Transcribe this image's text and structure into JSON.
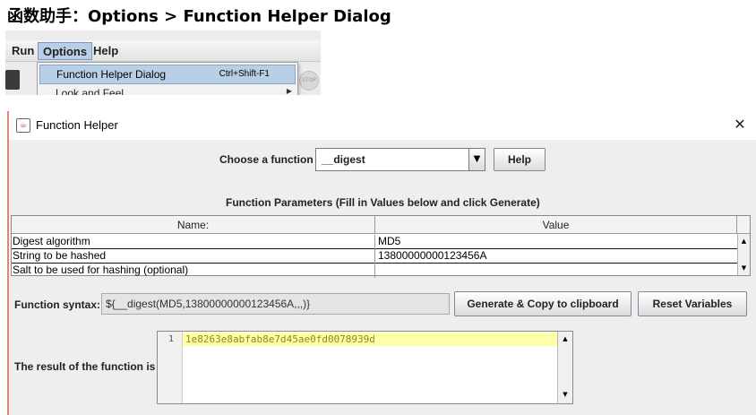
{
  "heading": "函数助手：Options > Function Helper Dialog",
  "menu": {
    "run_label": "Run",
    "options_label": "Options",
    "help_label": "Help",
    "dropdown_items": [
      {
        "label": "Function Helper Dialog",
        "shortcut": "Ctrl+Shift-F1",
        "selected": true
      },
      {
        "label": "Look and Feel",
        "has_submenu": true
      }
    ]
  },
  "dialog": {
    "title": "Function Helper",
    "close_icon": "close-icon",
    "choose_label": "Choose a function",
    "selected_function": "__digest",
    "help_button": "Help",
    "params_heading": "Function Parameters (Fill in Values below and click Generate)",
    "table": {
      "columns": [
        "Name:",
        "Value"
      ],
      "rows": [
        {
          "name": "Digest algorithm",
          "value": "MD5"
        },
        {
          "name": "String to be hashed",
          "value": "13800000000123456A"
        },
        {
          "name": "Salt to be used for hashing (optional)",
          "value": ""
        }
      ]
    },
    "syntax_label": "Function syntax:",
    "syntax_value": "${__digest(MD5,13800000000123456A,,,)}",
    "generate_button": "Generate & Copy to clipboard",
    "reset_button": "Reset Variables",
    "result_label": "The result of the function is",
    "result_line_number": "1",
    "result_value": "1e8263e8abfab8e7d45ae0fd0078939d"
  },
  "colors": {
    "menu_highlight": "#b8cfe5",
    "dialog_bg": "#eeeeee",
    "result_line_highlight": "#ffffaa",
    "dialog_left_border": "#d98b6a"
  }
}
